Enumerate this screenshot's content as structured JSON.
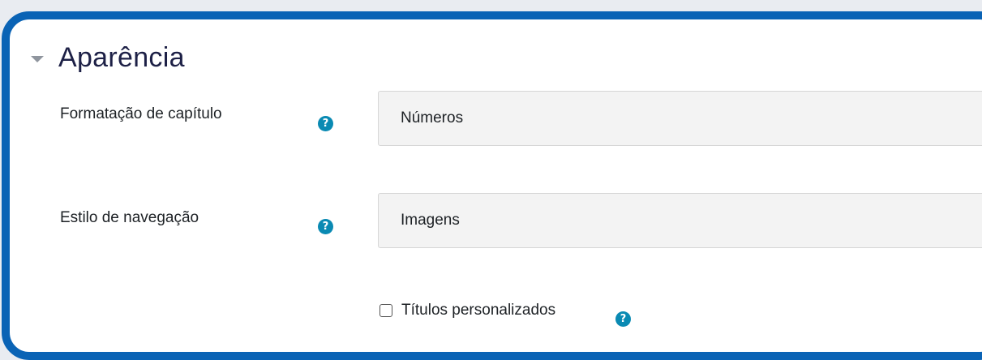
{
  "section": {
    "title": "Aparência",
    "icon": "collapse-caret-icon"
  },
  "fields": [
    {
      "label": "Formatação de capítulo",
      "value": "Números",
      "help_icon": "question-circle-icon"
    },
    {
      "label": "Estilo de navegação",
      "value": "Imagens",
      "help_icon": "question-circle-icon"
    }
  ],
  "checkbox": {
    "label": "Títulos personalizados",
    "checked": false,
    "help_icon": "question-circle-icon"
  },
  "help_glyph": "?",
  "colors": {
    "border": "#0a63b5",
    "help_icon": "#0a8ab3",
    "title": "#1d2046"
  }
}
